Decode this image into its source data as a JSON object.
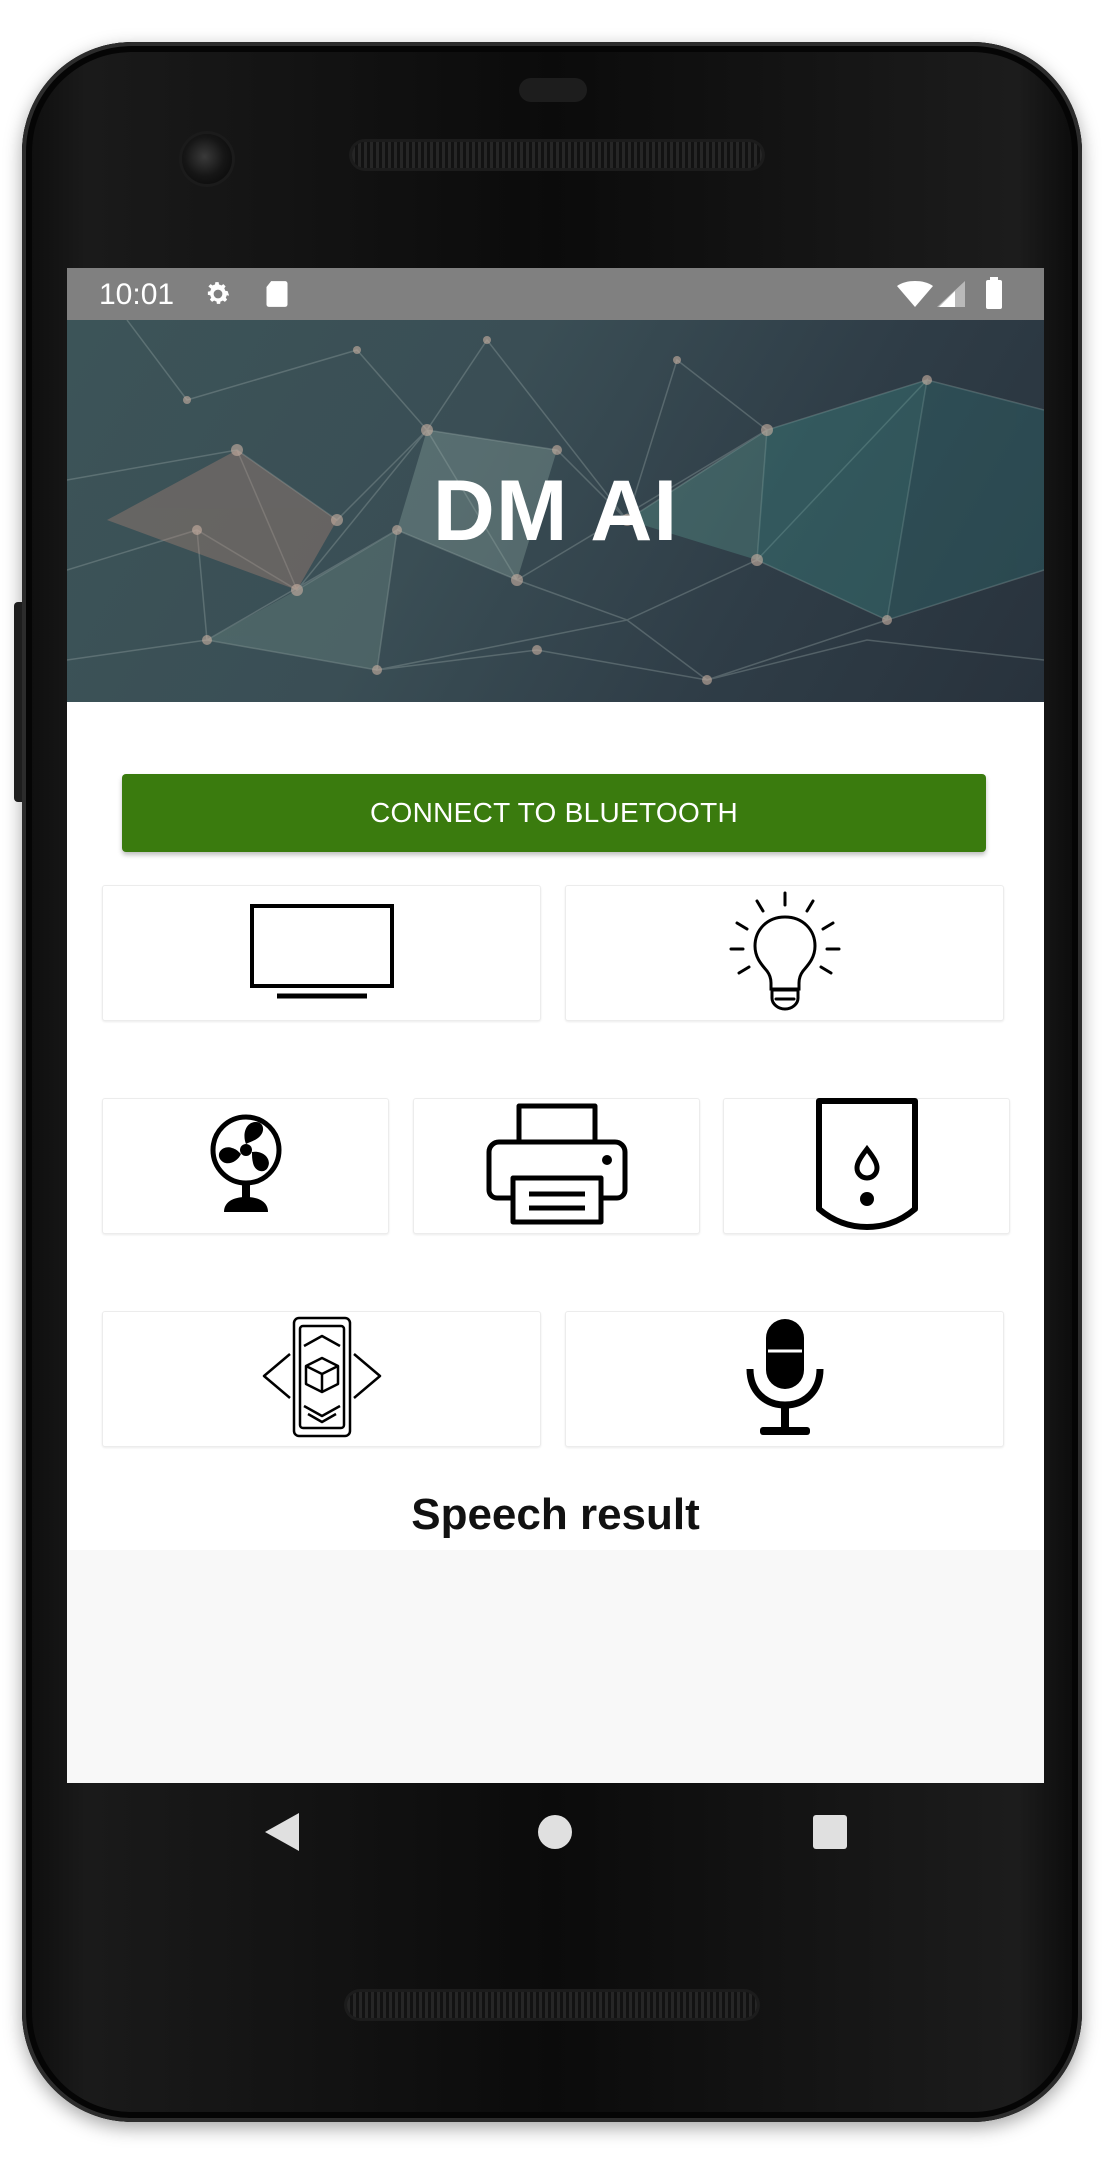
{
  "status_bar": {
    "time": "10:01",
    "icons": [
      "settings-icon",
      "sd-card-icon",
      "wifi-icon",
      "signal-icon",
      "battery-icon"
    ]
  },
  "header": {
    "title": "DM AI"
  },
  "connect_button": {
    "label": "CONNECT TO BLUETOOTH",
    "color": "#3a7b0e"
  },
  "device_tiles": [
    {
      "id": "tv",
      "icon": "tv-icon"
    },
    {
      "id": "light",
      "icon": "light-bulb-icon"
    },
    {
      "id": "fan",
      "icon": "fan-icon"
    },
    {
      "id": "printer",
      "icon": "printer-icon"
    },
    {
      "id": "water-heater",
      "icon": "water-heater-icon"
    },
    {
      "id": "ar-view",
      "icon": "ar-cube-icon"
    },
    {
      "id": "microphone",
      "icon": "microphone-icon"
    }
  ],
  "speech": {
    "label": "Speech result",
    "result": ""
  },
  "nav_bar": {
    "buttons": [
      "back-icon",
      "home-icon",
      "recents-icon"
    ]
  }
}
